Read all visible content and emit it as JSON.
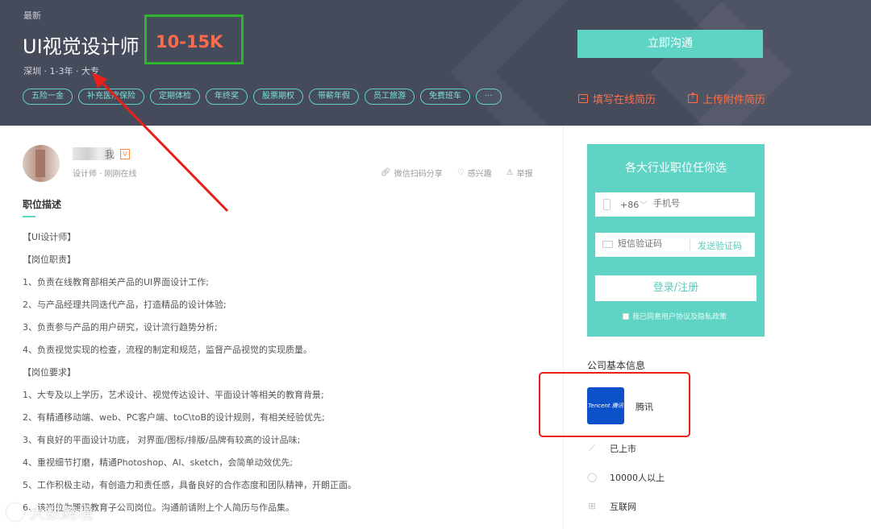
{
  "header": {
    "latest_label": "最新",
    "job_title": "UI视觉设计师",
    "salary": "10-15K",
    "meta": "深圳 · 1-3年 · 大专",
    "tags": [
      "五险一金",
      "补充医疗保险",
      "定期体检",
      "年终奖",
      "股票期权",
      "带薪年假",
      "员工旅游",
      "免费班车",
      "···"
    ],
    "chat_button": "立即沟通",
    "fill_resume": "填写在线简历",
    "upload_resume": "上传附件简历"
  },
  "recruiter": {
    "name_tail": "我",
    "verify_badge": "V",
    "role": "设计师 · 刚刚在线",
    "actions": {
      "share": "微信扫码分享",
      "interest": "感兴趣",
      "report": "举报"
    }
  },
  "description": {
    "title": "职位描述",
    "lines": [
      "【UI设计师】",
      "【岗位职责】",
      "1、负责在线教育部相关产品的UI界面设计工作;",
      "2、与产品经理共同迭代产品，打造精品的设计体验;",
      "3、负责参与产品的用户研究，设计流行趋势分析;",
      "4、负责视觉实现的检查，流程的制定和规范，监督产品视觉的实现质量。",
      "【岗位要求】",
      "1、大专及以上学历，艺术设计、视觉传达设计、平面设计等相关的教育背景;",
      "2、有精通移动端、web、PC客户端、toC\\toB的设计规则，有相关经验优先;",
      "3、有良好的平面设计功底， 对界面/图标/排版/品牌有较高的设计品味;",
      "4、重视细节打磨，精通Photoshop、AI、sketch，会简单动效优先;",
      "5、工作积极主动，有创造力和责任感，具备良好的合作态度和团队精神，开朗正面。",
      "6、该岗位为腾讯教育子公司岗位。沟通前请附上个人简历与作品集。"
    ]
  },
  "login": {
    "title": "各大行业职位任你选",
    "country_code": "+86",
    "phone_placeholder": "手机号",
    "code_placeholder": "短信验证码",
    "send_code": "发送验证码",
    "submit": "登录/注册",
    "agreement": "我已同意用户协议及隐私政策"
  },
  "company": {
    "section_title": "公司基本信息",
    "logo_text": "Tencent 腾讯",
    "name": "腾讯",
    "listing": "已上市",
    "size": "10000人以上",
    "industry": "互联网"
  },
  "watermark": "大数跨境"
}
